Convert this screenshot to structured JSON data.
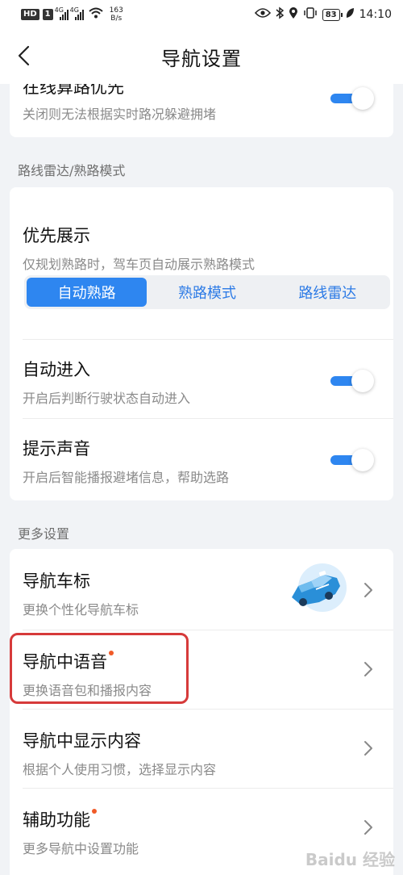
{
  "status_bar": {
    "hd_badge": "HD",
    "hd_num": "1",
    "net1": "4G",
    "net2": "4G",
    "speed_value": "163",
    "speed_unit": "B/s",
    "battery": "83",
    "time": "14:10"
  },
  "header": {
    "title": "导航设置"
  },
  "top_card": {
    "title": "在线算路优先",
    "desc": "关闭则无法根据实时路况躲避拥堵",
    "toggle_on": true
  },
  "section_route_radar": {
    "label": "路线雷达/熟路模式",
    "priority": {
      "title": "优先展示",
      "desc": "仅规划熟路时，驾车页自动展示熟路模式",
      "options": [
        "自动熟路",
        "熟路模式",
        "路线雷达"
      ],
      "selected": "自动熟路"
    },
    "auto_enter": {
      "title": "自动进入",
      "desc": "开启后判断行驶状态自动进入",
      "toggle_on": true
    },
    "sound": {
      "title": "提示声音",
      "desc": "开启后智能播报避堵信息，帮助选路",
      "toggle_on": true
    }
  },
  "section_more": {
    "label": "更多设置",
    "items": [
      {
        "title": "导航车标",
        "desc": "更换个性化导航车标",
        "new": false
      },
      {
        "title": "导航中语音",
        "desc": "更换语音包和播报内容",
        "new": true
      },
      {
        "title": "导航中显示内容",
        "desc": "根据个人使用习惯，选择显示内容",
        "new": false
      },
      {
        "title": "辅助功能",
        "desc": "更多导航中设置功能",
        "new": true
      }
    ]
  },
  "watermark": "Baidu 经验",
  "colors": {
    "accent": "#2e86f0",
    "highlight": "#d63a3a",
    "new_dot": "#f05a28"
  }
}
